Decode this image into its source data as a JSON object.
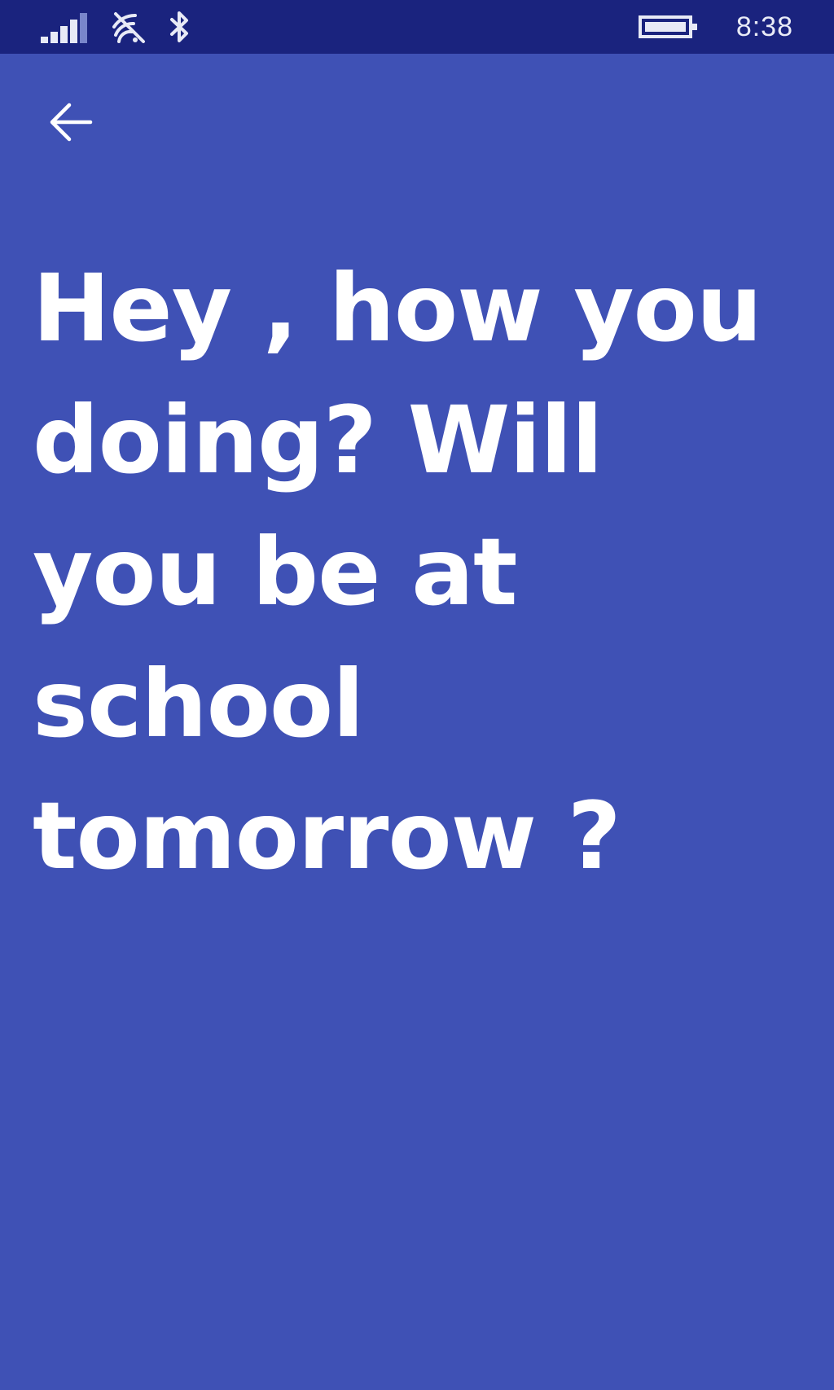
{
  "status_bar": {
    "icons": [
      "signal-strength-icon",
      "wifi-icon",
      "bluetooth-icon",
      "battery-icon"
    ],
    "time": "8:38"
  },
  "nav": {
    "back_icon": "back-arrow-icon"
  },
  "message": {
    "text": "Hey , how you doing? Will you be at school tomorrow ?"
  },
  "colors": {
    "background": "#3f51b5",
    "status_bar": "#1a237e",
    "text": "#ffffff"
  }
}
